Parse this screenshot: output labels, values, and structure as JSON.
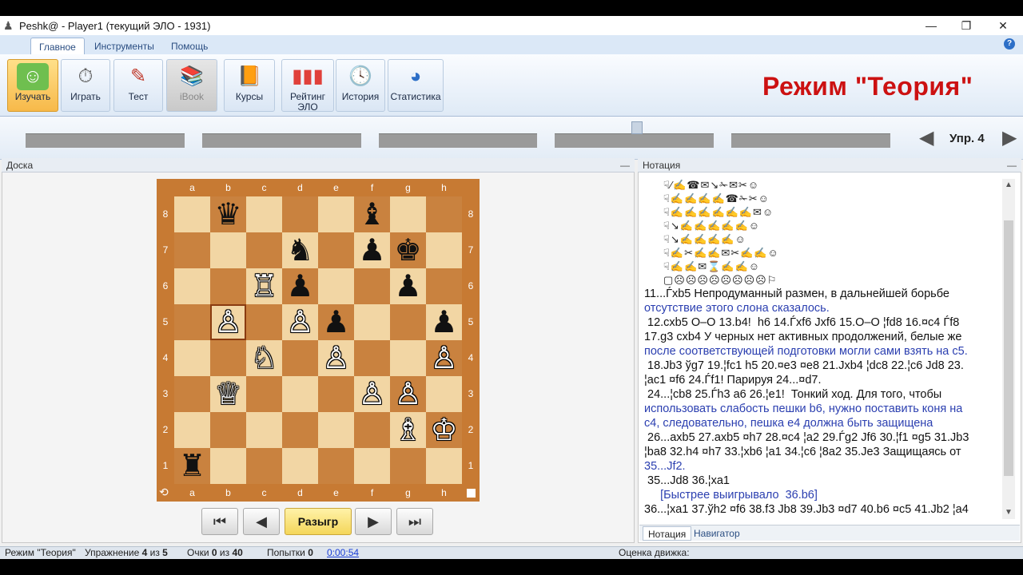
{
  "window": {
    "title": "Peshk@ -  Player1 (текущий ЭЛО - 1931)",
    "controls": [
      "—",
      "❐",
      "✕"
    ]
  },
  "ribbon_tabs": [
    {
      "label": "Главное",
      "active": true
    },
    {
      "label": "Инструменты",
      "active": false
    },
    {
      "label": "Помощь",
      "active": false
    }
  ],
  "ribbon_buttons": [
    {
      "label": "Изучать",
      "icon": "student-icon",
      "state": "active"
    },
    {
      "label": "Играть",
      "icon": "chess-clock-icon",
      "state": "normal"
    },
    {
      "label": "Тест",
      "icon": "test-pencil-icon",
      "state": "normal"
    },
    {
      "label": "iBook",
      "icon": "books-icon",
      "state": "disabled"
    },
    {
      "label": "Курсы",
      "icon": "courses-icon",
      "state": "normal"
    },
    {
      "label": "Рейтинг ЭЛО",
      "icon": "rating-chart-icon",
      "state": "normal"
    },
    {
      "label": "История",
      "icon": "history-clock-icon",
      "state": "normal"
    },
    {
      "label": "Статистика",
      "icon": "pie-chart-icon",
      "state": "normal"
    }
  ],
  "mode_title": "Режим \"Теория\"",
  "exercise_nav": {
    "label": "Упр. 4"
  },
  "board_panel": {
    "title": "Доска"
  },
  "notation_panel": {
    "title": "Нотация"
  },
  "board": {
    "files": [
      "a",
      "b",
      "c",
      "d",
      "e",
      "f",
      "g",
      "h"
    ],
    "ranks": [
      "8",
      "7",
      "6",
      "5",
      "4",
      "3",
      "2",
      "1"
    ],
    "highlight": "b5",
    "pieces": [
      {
        "sq": "b8",
        "glyph": "♛",
        "color": "b"
      },
      {
        "sq": "f8",
        "glyph": "♝",
        "color": "b"
      },
      {
        "sq": "d7",
        "glyph": "♞",
        "color": "b"
      },
      {
        "sq": "f7",
        "glyph": "♟",
        "color": "b"
      },
      {
        "sq": "g7",
        "glyph": "♚",
        "color": "b"
      },
      {
        "sq": "c6",
        "glyph": "♖",
        "color": "w"
      },
      {
        "sq": "d6",
        "glyph": "♟",
        "color": "b"
      },
      {
        "sq": "g6",
        "glyph": "♟",
        "color": "b"
      },
      {
        "sq": "b5",
        "glyph": "♙",
        "color": "w"
      },
      {
        "sq": "d5",
        "glyph": "♙",
        "color": "w"
      },
      {
        "sq": "e5",
        "glyph": "♟",
        "color": "b"
      },
      {
        "sq": "h5",
        "glyph": "♟",
        "color": "b"
      },
      {
        "sq": "c4",
        "glyph": "♘",
        "color": "w"
      },
      {
        "sq": "e4",
        "glyph": "♙",
        "color": "w"
      },
      {
        "sq": "h4",
        "glyph": "♙",
        "color": "w"
      },
      {
        "sq": "b3",
        "glyph": "♕",
        "color": "w"
      },
      {
        "sq": "f3",
        "glyph": "♙",
        "color": "w"
      },
      {
        "sq": "g3",
        "glyph": "♙",
        "color": "w"
      },
      {
        "sq": "g2",
        "glyph": "♗",
        "color": "w"
      },
      {
        "sq": "h2",
        "glyph": "♔",
        "color": "w"
      },
      {
        "sq": "a1",
        "glyph": "♜",
        "color": "b"
      }
    ]
  },
  "nav_buttons": {
    "first": "⏮",
    "prev": "◀",
    "razygr": "Разыгр",
    "next": "▶",
    "last": "⏭"
  },
  "notation": {
    "glyph_lines": [
      "☟⁄✍☎✉↘✁✉✂☺",
      "☟✍✍✍✍☎✁✂☺",
      "☟✍✍✍✍✍✍✉☺",
      "☟↘✍✍✍✍✍☺",
      "☟↘✍✍✍✍☺",
      "☟✍✂✍✍✉✂✍✍☺",
      "☟✍✍✉⌛✍✍☺",
      "▢☹☹☹☹☹☹☹☹⚐"
    ],
    "lines": [
      {
        "text": "11...Ѓxb5 Непродуманный размен, в дальнейшей борьбе",
        "blue": false
      },
      {
        "text": "отсутствие этого слона сказалось.",
        "blue": true
      },
      {
        "text": " 12.cxb5 O–O 13.b4!  h6 14.Ѓxf6 Jxf6 15.O–O ¦fd8 16.¤c4 Ѓf8",
        "blue": false
      },
      {
        "text": "17.g3 cxb4 У черных нет активных продолжений, белые же",
        "blue": false
      },
      {
        "text": "после соответствующей подготовки могли сами взять на с5.",
        "blue": true
      },
      {
        "text": " 18.Jb3 ўg7 19.¦fc1 h5 20.¤e3 ¤e8 21.Jxb4 ¦dc8 22.¦c6 Jd8 23.",
        "blue": false
      },
      {
        "text": "¦ac1 ¤f6 24.Ѓf1! Парируя 24...¤d7.",
        "blue": false
      },
      {
        "text": " 24...¦cb8 25.Ѓh3 a6 26.¦e1!  Тонкий ход. Для того, чтобы",
        "blue": false
      },
      {
        "text": "использовать слабость пешки b6, нужно поставить коня на",
        "blue": true
      },
      {
        "text": "с4, следовательно, пешка е4 должна быть защищена",
        "blue": true
      },
      {
        "text": " 26...axb5 27.axb5 ¤h7 28.¤c4 ¦a2 29.Ѓg2 Jf6 30.¦f1 ¤g5 31.Jb3",
        "blue": false
      },
      {
        "text": "¦ba8 32.h4 ¤h7 33.¦xb6 ¦a1 34.¦c6 ¦8a2 35.Je3 Защищаясь от",
        "blue": false
      },
      {
        "text": "35...Jf2.",
        "blue": true
      },
      {
        "text": " 35...Jd8 36.¦xa1",
        "blue": false
      },
      {
        "text": "     [Быстрее выигрывало  36.b6]",
        "blue": true
      },
      {
        "text": "36...¦xa1 37.ўh2 ¤f6 38.f3 Jb8 39.Jb3 ¤d7 40.b6 ¤c5 41.Jb2 ¦a4",
        "blue": false
      }
    ]
  },
  "notation_tabs": [
    {
      "label": "Нотация",
      "active": true
    },
    {
      "label": "Навигатор",
      "active": false
    }
  ],
  "status": {
    "mode": "Режим \"Теория\"",
    "exercise_prefix": "Упражнение ",
    "exercise_num": "4",
    "exercise_mid": " из ",
    "exercise_total": "5",
    "points_prefix": "Очки ",
    "points_val": "0",
    "points_mid": " из ",
    "points_total": "40",
    "attempts_prefix": "Попытки ",
    "attempts_val": "0",
    "time": "0:00:54",
    "engine_label": "Оценка движка:"
  }
}
